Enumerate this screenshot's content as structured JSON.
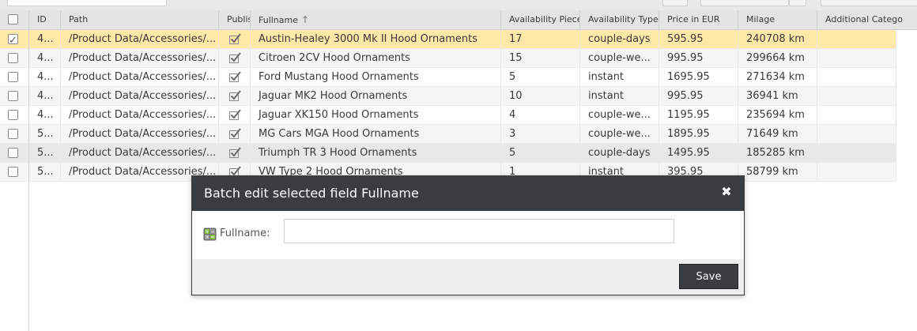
{
  "grid": {
    "columns": [
      "ID",
      "Path",
      "Publis",
      "Fullname",
      "Availability Pieces",
      "Availability Type",
      "Price in EUR",
      "Milage",
      "Additional Catego"
    ],
    "sort_indicator": "↑",
    "rows": [
      {
        "id": "4...",
        "path": "/Product Data/Accessories/...",
        "fullname": "Austin-Healey 3000 Mk II Hood Ornaments",
        "pieces": "17",
        "type": "couple-days",
        "price": "595.95",
        "milage": "240708 km",
        "checked": true
      },
      {
        "id": "4...",
        "path": "/Product Data/Accessories/...",
        "fullname": "Citroen 2CV Hood Ornaments",
        "pieces": "15",
        "type": "couple-we...",
        "price": "995.95",
        "milage": "299664 km",
        "checked": false
      },
      {
        "id": "4...",
        "path": "/Product Data/Accessories/...",
        "fullname": "Ford Mustang Hood Ornaments",
        "pieces": "5",
        "type": "instant",
        "price": "1695.95",
        "milage": "271634 km",
        "checked": false
      },
      {
        "id": "4...",
        "path": "/Product Data/Accessories/...",
        "fullname": "Jaguar MK2 Hood Ornaments",
        "pieces": "10",
        "type": "instant",
        "price": "995.95",
        "milage": "36941 km",
        "checked": false
      },
      {
        "id": "4...",
        "path": "/Product Data/Accessories/...",
        "fullname": "Jaguar XK150 Hood Ornaments",
        "pieces": "4",
        "type": "couple-we...",
        "price": "1195.95",
        "milage": "235694 km",
        "checked": false
      },
      {
        "id": "5...",
        "path": "/Product Data/Accessories/...",
        "fullname": "MG Cars MGA Hood Ornaments",
        "pieces": "3",
        "type": "couple-we...",
        "price": "1895.95",
        "milage": "71649 km",
        "checked": false
      },
      {
        "id": "5...",
        "path": "/Product Data/Accessories/...",
        "fullname": "Triumph TR 3 Hood Ornaments",
        "pieces": "5",
        "type": "couple-days",
        "price": "1495.95",
        "milage": "185285 km",
        "checked": false
      },
      {
        "id": "5...",
        "path": "/Product Data/Accessories/...",
        "fullname": "VW Type 2 Hood Ornaments",
        "pieces": "1",
        "type": "instant",
        "price": "395.95",
        "milage": "58799 km",
        "checked": false
      }
    ]
  },
  "modal": {
    "title": "Batch edit selected field Fullname",
    "field_label": "Fullname:",
    "field_value": "",
    "save_label": "Save",
    "close_icon": "close-icon"
  },
  "colors": {
    "selected_row": "#ffe8a8",
    "modal_header": "#3a3d3f"
  }
}
